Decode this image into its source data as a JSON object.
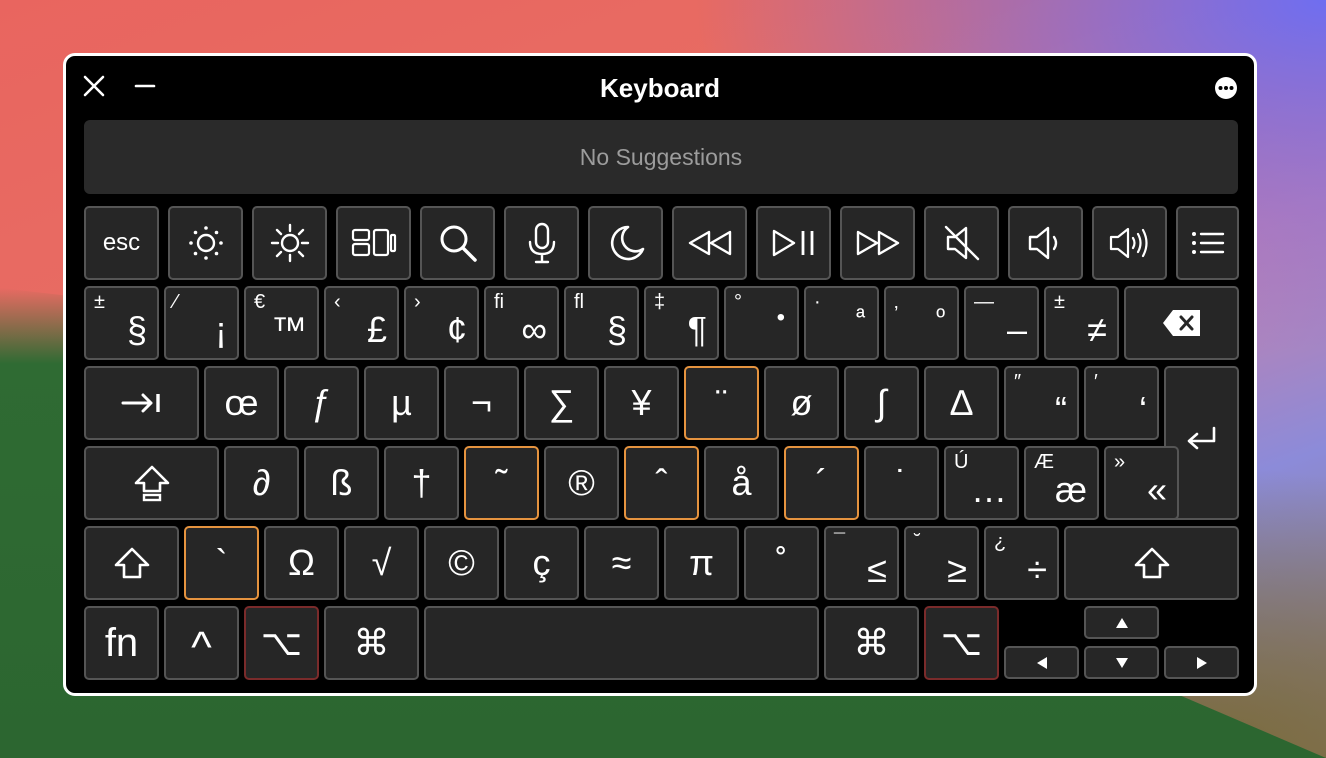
{
  "window": {
    "title": "Keyboard"
  },
  "suggestions": {
    "text": "No Suggestions"
  },
  "fn_row": {
    "esc": "esc"
  },
  "row1": [
    {
      "top": "±",
      "main": "§"
    },
    {
      "top": "⁄",
      "main": "¡"
    },
    {
      "top": "€",
      "main": "™"
    },
    {
      "top": "‹",
      "main": "£"
    },
    {
      "top": "›",
      "main": "¢"
    },
    {
      "top": "ﬁ",
      "main": "∞"
    },
    {
      "top": "ﬂ",
      "main": "§"
    },
    {
      "top": "‡",
      "main": "¶"
    },
    {
      "top": "°",
      "main": "•"
    },
    {
      "top": "·",
      "main": "ª"
    },
    {
      "top": "‚",
      "main": "º"
    },
    {
      "top": "—",
      "main": "–"
    },
    {
      "top": "±",
      "main": "≠"
    }
  ],
  "row2": [
    "œ",
    "ƒ",
    "µ",
    "¬",
    "∑",
    "¥",
    "¨",
    "ø",
    "∫",
    "∆"
  ],
  "row2_pairs": [
    {
      "top": "″",
      "main": "“"
    },
    {
      "top": "′",
      "main": "‘"
    }
  ],
  "row3": [
    "∂",
    "ß",
    "†",
    "˜",
    "®",
    "ˆ",
    "å",
    "´",
    "˙"
  ],
  "row3_pairs": [
    {
      "top": "Ú",
      "main": "…"
    },
    {
      "top": "Æ",
      "main": "æ"
    },
    {
      "top": "»",
      "main": "«"
    }
  ],
  "row4": [
    "`",
    "Ω",
    "√",
    "©",
    "ç",
    "≈",
    "π",
    "˚"
  ],
  "row4_pairs": [
    {
      "top": "¯",
      "main": "≤"
    },
    {
      "top": "˘",
      "main": "≥"
    },
    {
      "top": "¿",
      "main": "÷"
    }
  ],
  "row5": {
    "fn": "fn",
    "control": "^",
    "option": "⌥",
    "command": "⌘"
  },
  "colors": {
    "highlight": "#e5933f",
    "active_option": "#7a2b2b",
    "key_bg": "#262626"
  }
}
